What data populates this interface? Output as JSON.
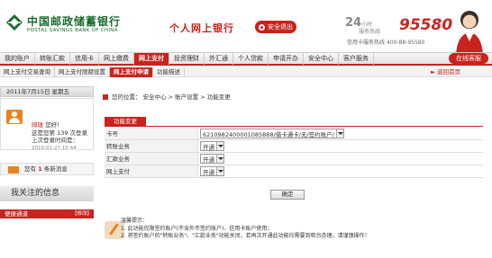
{
  "header": {
    "logo_cn": "中国邮政储蓄银行",
    "logo_en": "POSTAL SAVINGS BANK OF CHINA",
    "site_title": "个人网上银行",
    "logout_label": "安全退出",
    "hotline_24": "24",
    "hotline_24_unit": "小时",
    "hotline_label": "服务热线",
    "hotline_number": "95580",
    "card_hotline": "信用卡服务热线 400-88-95580",
    "brand_color": "#c8231e",
    "green_color": "#1a6a2e"
  },
  "nav": {
    "items": [
      {
        "label": "我的账户",
        "active": false
      },
      {
        "label": "转账汇款",
        "active": false
      },
      {
        "label": "信用卡",
        "active": false
      },
      {
        "label": "网上缴费",
        "active": false
      },
      {
        "label": "网上支付",
        "active": true
      },
      {
        "label": "投资理财",
        "active": false
      },
      {
        "label": "外汇通",
        "active": false
      },
      {
        "label": "个人贷款",
        "active": false
      },
      {
        "label": "申请开办",
        "active": false
      },
      {
        "label": "安全中心",
        "active": false
      },
      {
        "label": "客户服务",
        "active": false
      }
    ],
    "online_cs": "在线客服"
  },
  "subnav": {
    "items": [
      {
        "label": "网上支付交易查询",
        "active": false
      },
      {
        "label": "网上支付限额设置",
        "active": false
      },
      {
        "label": "网上支付申请",
        "active": true
      },
      {
        "label": "功能描述",
        "active": false
      }
    ],
    "back_home": "返回首页"
  },
  "sidebar": {
    "date": "2011年7月15日 星期五",
    "user_name": "邮雄",
    "greeting": "您好!",
    "login_count_line": "这是您第 139 次登录",
    "last_login_label": "上次登录时间是：",
    "last_login_time": "2010-01-27 15:44",
    "message_text_pre": "您有",
    "message_count": "1",
    "message_text_post": "条新消息",
    "follow_title": "我关注的信息",
    "quick_title": "便捷通道",
    "quick_edit": "【修改】"
  },
  "main": {
    "breadcrumb": "您的位置： 安全中心 > 账户设置 > 功能变更",
    "section_title": "功能变更",
    "rows": [
      {
        "label": "卡号",
        "value": "6210982400001085888/借卡通卡/无/签约账户/"
      },
      {
        "label": "转账业务",
        "value": "开通"
      },
      {
        "label": "汇款业务",
        "value": "开通"
      },
      {
        "label": "网上支付",
        "value": "开通"
      }
    ],
    "confirm_label": "确定",
    "tips_title": "温馨提示：",
    "tips": [
      "1. 此功能仅限签约账户(不含外币签约账户)、信用卡账户使用；",
      "2. 将签约账户的\"转账业务\"、\"汇款业务\"功能关闭，若再次开通此功能均需要到柜台办理。请谨慎操作！"
    ]
  }
}
